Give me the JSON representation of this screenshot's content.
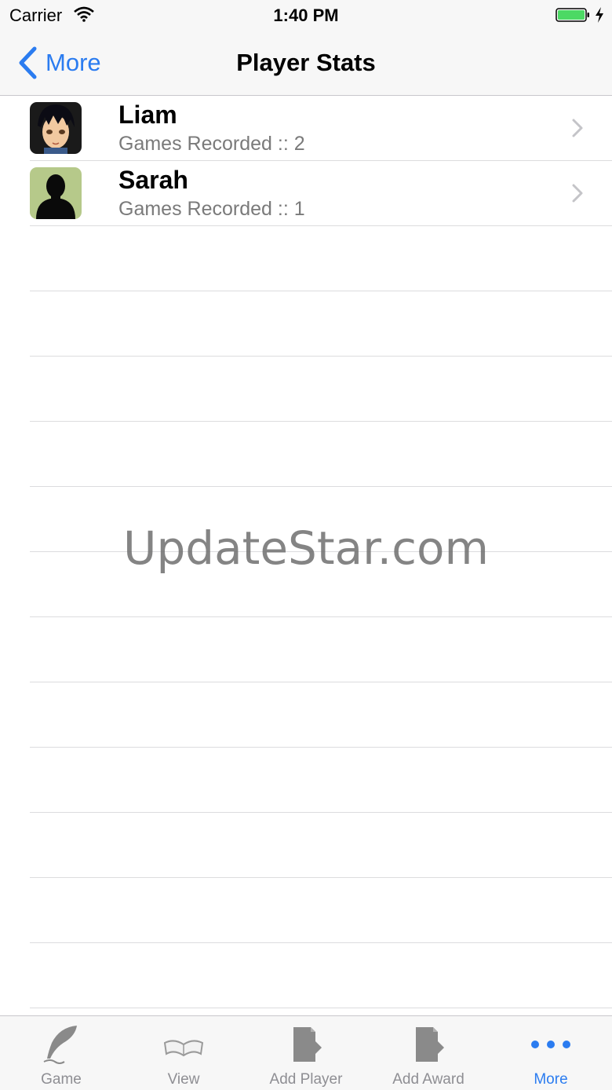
{
  "status_bar": {
    "carrier": "Carrier",
    "time": "1:40 PM"
  },
  "nav": {
    "back_label": "More",
    "title": "Player Stats"
  },
  "players": [
    {
      "name": "Liam",
      "subtitle": "Games Recorded :: 2",
      "avatar": "anime-boy-avatar"
    },
    {
      "name": "Sarah",
      "subtitle": "Games Recorded :: 1",
      "avatar": "silhouette-avatar"
    }
  ],
  "watermark": "UpdateStar.com",
  "tabs": [
    {
      "label": "Game",
      "icon": "quill-icon",
      "active": false
    },
    {
      "label": "View",
      "icon": "book-icon",
      "active": false
    },
    {
      "label": "Add Player",
      "icon": "add-document-icon",
      "active": false
    },
    {
      "label": "Add Award",
      "icon": "add-document-icon",
      "active": false
    },
    {
      "label": "More",
      "icon": "more-dots-icon",
      "active": true
    }
  ],
  "colors": {
    "accent": "#2b7cf0",
    "battery": "#4cd964",
    "tab_inactive": "#8e8e93"
  }
}
